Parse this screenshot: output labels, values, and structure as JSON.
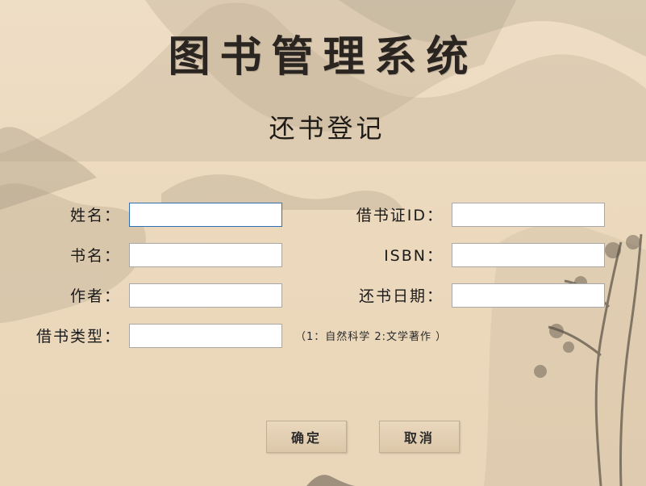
{
  "window": {
    "app_title": "图书管理系统",
    "page_title": "还书登记"
  },
  "form": {
    "name": {
      "label": "姓名：",
      "value": ""
    },
    "card_id": {
      "label": "借书证ID：",
      "value": ""
    },
    "book_name": {
      "label": "书名：",
      "value": ""
    },
    "isbn": {
      "label": "ISBN：",
      "value": ""
    },
    "author": {
      "label": "作者：",
      "value": ""
    },
    "return_date": {
      "label": "还书日期：",
      "value": ""
    },
    "borrow_type": {
      "label": "借书类型：",
      "value": "",
      "hint": "（1：自然科学 2:文学著作 ）"
    }
  },
  "buttons": {
    "confirm": "确定",
    "cancel": "取消"
  },
  "colors": {
    "background": "#ead8bd",
    "focus_border": "#2f6fb5",
    "ink": "#2a2520"
  }
}
